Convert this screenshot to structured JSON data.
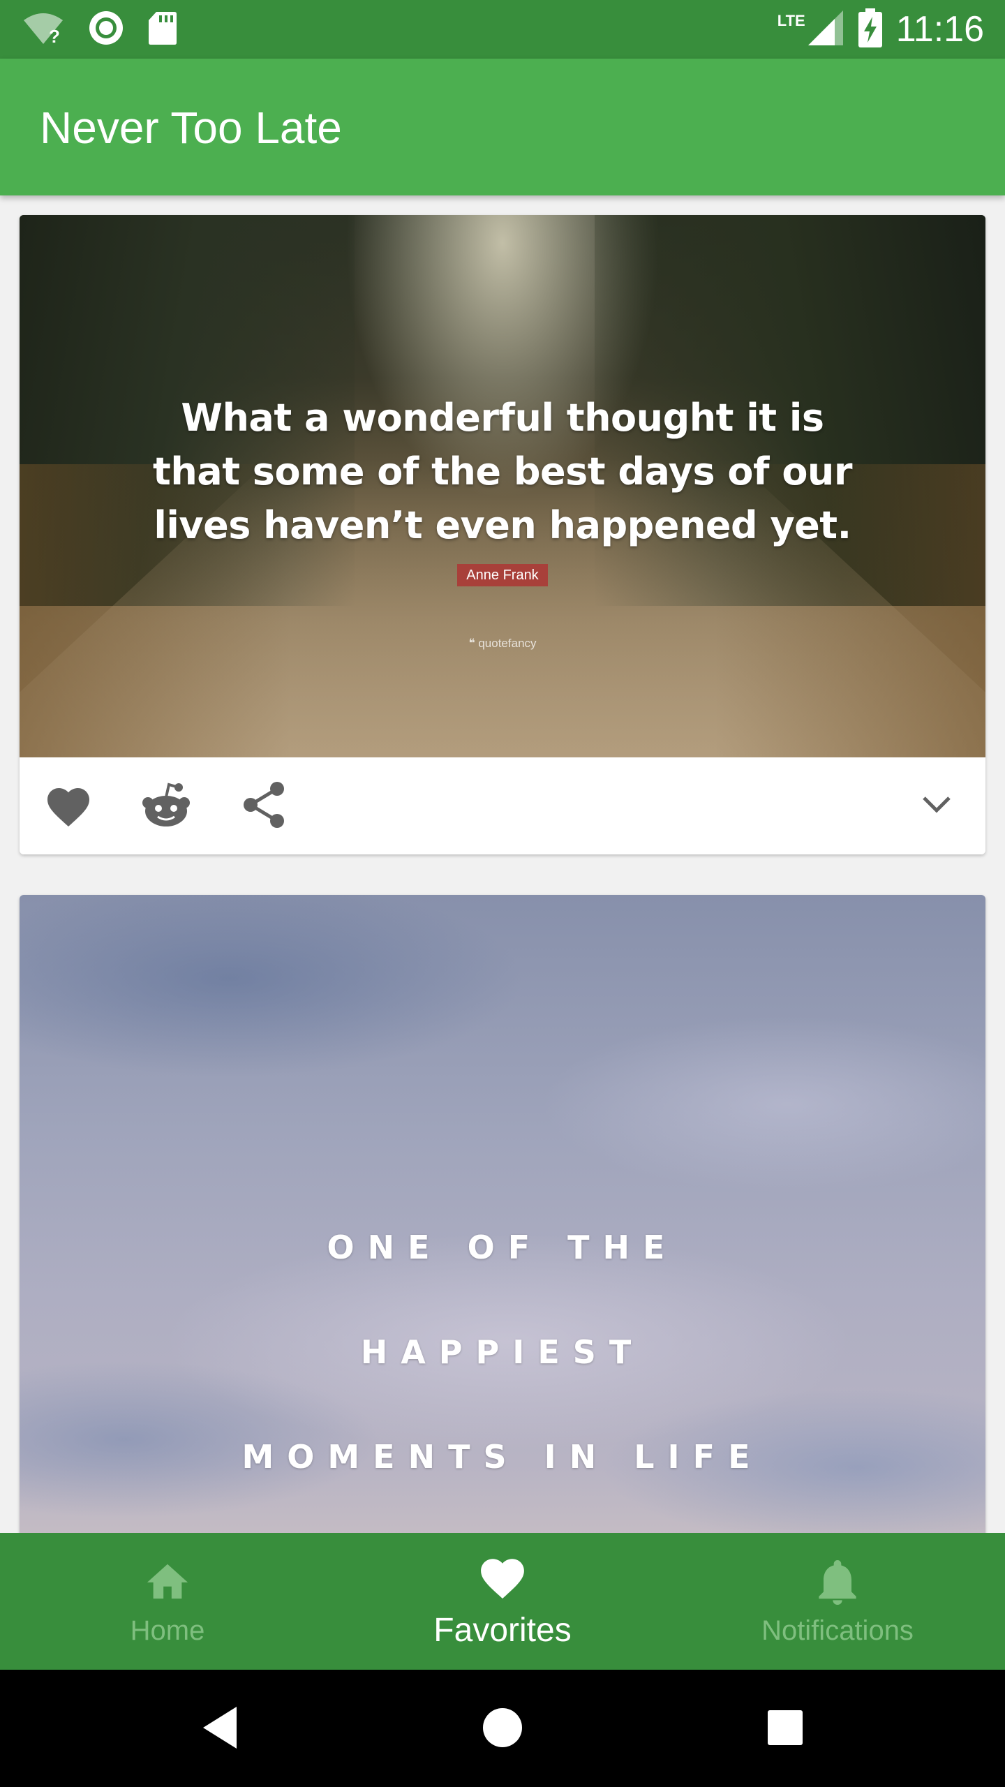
{
  "status_bar": {
    "time": "11:16",
    "network_label": "LTE",
    "icons": [
      "wifi-question-icon",
      "sync-icon",
      "sd-card-icon",
      "signal-icon",
      "battery-charging-icon"
    ]
  },
  "app_bar": {
    "title": "Never Too Late"
  },
  "cards": [
    {
      "quote_lines": [
        "What a wonderful thought it is",
        "that some of the best days of our",
        "lives haven’t even happened yet."
      ],
      "author": "Anne Frank",
      "watermark": "quotefancy",
      "actions": [
        "heart-icon",
        "reddit-icon",
        "share-icon",
        "chevron-down-icon"
      ]
    },
    {
      "quote_lines": [
        "ONE OF THE",
        "HAPPIEST",
        "MOMENTS IN LIFE"
      ]
    }
  ],
  "bottom_nav": {
    "items": [
      {
        "label": "Home",
        "icon": "home-icon",
        "active": false
      },
      {
        "label": "Favorites",
        "icon": "heart-icon",
        "active": true
      },
      {
        "label": "Notifications",
        "icon": "bell-icon",
        "active": false
      }
    ]
  },
  "colors": {
    "status_bar": "#388e3c",
    "app_bar": "#4caf50",
    "bottom_nav": "#388e3c",
    "icon_grey": "#616161",
    "inactive_nav": "#7fbf7f"
  }
}
